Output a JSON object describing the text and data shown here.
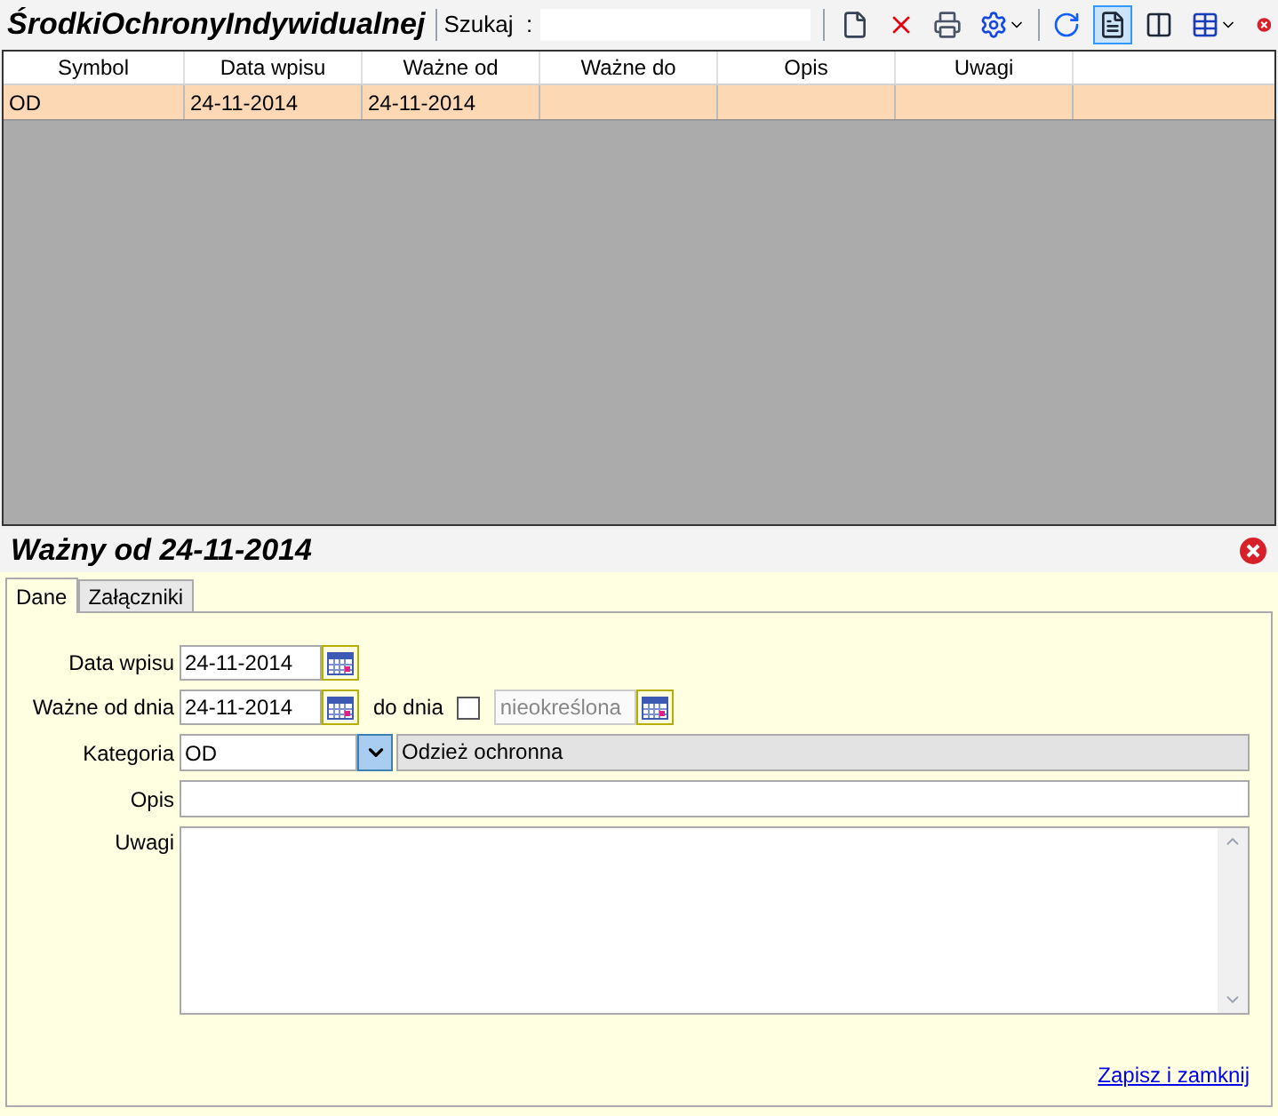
{
  "list_title": "ŚrodkiOchronyIndywidualnej",
  "search": {
    "label": "Szukaj  :"
  },
  "toolbar": [
    {
      "selected": false,
      "has_menu": false
    },
    {
      "selected": false,
      "has_menu": false
    },
    {
      "selected": false,
      "has_menu": false
    },
    {
      "selected": false,
      "has_menu": true
    },
    {
      "selected": false,
      "has_menu": false
    },
    {
      "selected": true,
      "has_menu": false
    },
    {
      "selected": false,
      "has_menu": false
    },
    {
      "selected": false,
      "has_menu": true
    }
  ],
  "table": {
    "columns": [
      "Symbol",
      "Data wpisu",
      "Ważne od",
      "Ważne do",
      "Opis",
      "Uwagi"
    ],
    "rows": [
      {
        "selected": true,
        "cells": [
          "OD",
          "24-11-2014",
          "24-11-2014",
          "",
          "",
          ""
        ]
      }
    ]
  },
  "detail": {
    "title": "Ważny od 24-11-2014",
    "tabs": [
      {
        "label": "Dane",
        "selected": true
      },
      {
        "label": "Załączniki",
        "selected": false
      }
    ],
    "entry_date": {
      "label": "Data wpisu",
      "value": "24-11-2014"
    },
    "valid_from": {
      "label": "Ważne od dnia",
      "value": "24-11-2014"
    },
    "valid_to": {
      "label": "do dnia",
      "checked": false,
      "value": "nieokreślona",
      "disabled": true
    },
    "category": {
      "label": "Kategoria",
      "code": "OD",
      "name": "Odzież ochronna"
    },
    "description": {
      "label": "Opis"
    },
    "notes": {
      "label": "Uwagi"
    },
    "save_link": "Zapisz i zamknij"
  }
}
